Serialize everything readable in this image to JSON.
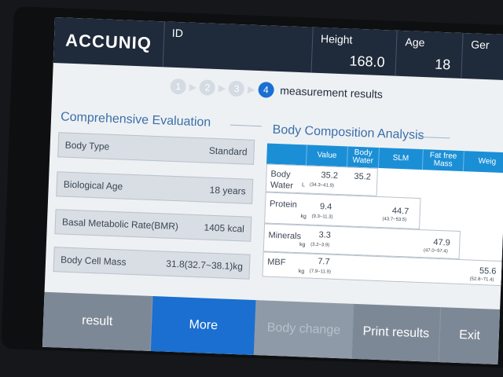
{
  "header": {
    "logo": "ACCUNIQ",
    "id_label": "ID",
    "id_value": "",
    "height_label": "Height",
    "height_value": "168.0",
    "age_label": "Age",
    "age_value": "18",
    "gender_label": "Ger"
  },
  "steps": {
    "numbers": [
      "1",
      "2",
      "3",
      "4"
    ],
    "active_label": "measurement results"
  },
  "evaluation": {
    "title": "Comprehensive Evaluation",
    "rows": [
      {
        "label": "Body Type",
        "value": "Standard"
      },
      {
        "label": "Biological Age",
        "value": "18 years"
      },
      {
        "label": "Basal Metabolic Rate(BMR)",
        "value": "1405 kcal"
      },
      {
        "label": "Body Cell Mass",
        "value": "31.8(32.7~38.1)kg"
      }
    ]
  },
  "composition": {
    "title": "Body Composition Analysis",
    "headers": [
      "Value",
      "Body Water",
      "SLM",
      "Fat free Mass",
      "Weig"
    ],
    "rows": [
      {
        "label": "Body Water",
        "unit": "L",
        "value": "35.2",
        "range": "(34.3~41.9)"
      },
      {
        "label": "Protein",
        "unit": "kg",
        "value": "9.4",
        "range": "(9.3~11.3)"
      },
      {
        "label": "Minerals",
        "unit": "kg",
        "value": "3.3",
        "range": "(3.2~3.9)"
      },
      {
        "label": "MBF",
        "unit": "kg",
        "value": "7.7",
        "range": "(7.9~11.9)"
      }
    ],
    "body_water_total": "35.2",
    "slm_value": "44.7",
    "slm_range": "(43.7~53.5)",
    "ffm_value": "47.9",
    "ffm_range": "(47.0~57.4)",
    "weight_value": "55.6",
    "weight_range": "(52.8~71.4)"
  },
  "nav": {
    "result": "result",
    "more": "More",
    "body_change": "Body change",
    "print": "Print results",
    "exit": "Exit"
  }
}
